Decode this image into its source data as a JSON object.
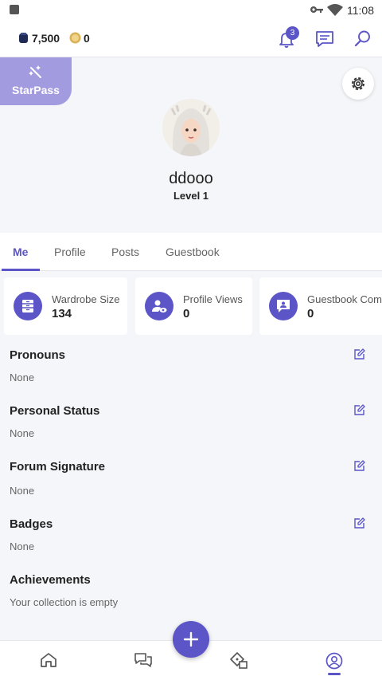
{
  "status_bar": {
    "time": "11:08"
  },
  "top_bar": {
    "gems": "7,500",
    "coins": "0",
    "notification_count": "3"
  },
  "header": {
    "starpass_label": "StarPass",
    "username": "ddooo",
    "level": "Level 1"
  },
  "tabs": [
    {
      "label": "Me",
      "active": true
    },
    {
      "label": "Profile",
      "active": false
    },
    {
      "label": "Posts",
      "active": false
    },
    {
      "label": "Guestbook",
      "active": false
    }
  ],
  "stats": [
    {
      "label": "Wardrobe Size",
      "value": "134"
    },
    {
      "label": "Profile Views",
      "value": "0"
    },
    {
      "label": "Guestbook Com",
      "value": "0"
    }
  ],
  "sections": [
    {
      "title": "Pronouns",
      "value": "None"
    },
    {
      "title": "Personal Status",
      "value": "None"
    },
    {
      "title": "Forum Signature",
      "value": "None"
    },
    {
      "title": "Badges",
      "value": "None"
    },
    {
      "title": "Achievements",
      "value": "Your collection is empty"
    }
  ],
  "colors": {
    "accent": "#5b55c7",
    "starpass": "#a39be0",
    "background": "#f4f6f9"
  },
  "icons": {
    "status": [
      "key-icon",
      "wifi-icon"
    ],
    "top": [
      "gems-icon",
      "coin-icon",
      "bell-icon",
      "chat-icon",
      "search-icon"
    ],
    "nav": [
      "home-icon",
      "forum-icon",
      "shop-icon",
      "profile-icon"
    ]
  }
}
